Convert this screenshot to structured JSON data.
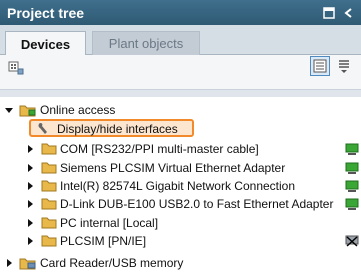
{
  "title": "Project tree",
  "tabs": {
    "devices": "Devices",
    "plant_objects": "Plant objects"
  },
  "tree": {
    "online_access": "Online access",
    "display_hide_interfaces": "Display/hide interfaces",
    "items": [
      "COM [RS232/PPI multi-master cable]",
      "Siemens PLCSIM Virtual Ethernet Adapter",
      "Intel(R) 82574L Gigabit Network Connection",
      "D-Link DUB-E100 USB2.0 to Fast Ethernet Adapter",
      "PC internal [Local]",
      "PLCSIM [PN/IE]"
    ],
    "card_reader": "Card Reader/USB memory"
  },
  "colors": {
    "title_bar": "#2f5a74",
    "highlight_border": "#f28a2c",
    "highlight_fill": "#fde6cf",
    "folder": "#e8b84a",
    "status_green": "#3aa635"
  }
}
